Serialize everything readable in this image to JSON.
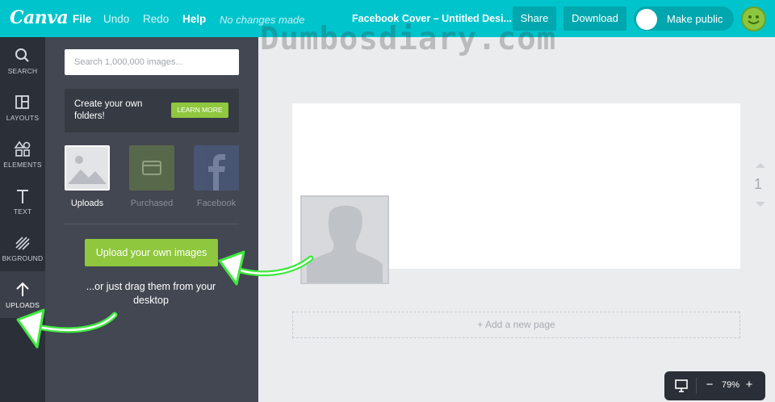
{
  "topbar": {
    "logo": "Canva",
    "menu": [
      "File",
      "Undo",
      "Redo",
      "Help"
    ],
    "status": "No changes made",
    "doc_title": "Facebook Cover – Untitled Desi...",
    "share": "Share",
    "download": "Download",
    "make_public": "Make public"
  },
  "watermark": "Dumbosdiary.com",
  "rail": {
    "items": [
      {
        "label": "SEARCH",
        "icon": "search-icon"
      },
      {
        "label": "LAYOUTS",
        "icon": "layouts-icon"
      },
      {
        "label": "ELEMENTS",
        "icon": "elements-icon"
      },
      {
        "label": "TEXT",
        "icon": "text-icon"
      },
      {
        "label": "BKGROUND",
        "icon": "background-icon"
      },
      {
        "label": "UPLOADS",
        "icon": "upload-icon"
      }
    ],
    "active": "UPLOADS"
  },
  "panel": {
    "search_placeholder": "Search 1,000,000 images...",
    "folder_text": "Create your own folders!",
    "learn_more": "LEARN MORE",
    "tabs": [
      {
        "label": "Uploads",
        "icon": "uploads-image-icon"
      },
      {
        "label": "Purchased",
        "icon": "purchased-card-icon"
      },
      {
        "label": "Facebook",
        "icon": "facebook-icon"
      }
    ],
    "upload_button": "Upload your own images",
    "drag_text": "...or just drag them from your desktop"
  },
  "canvas": {
    "add_page": "+ Add a new page",
    "page_number": "1"
  },
  "zoom": {
    "level": "79%",
    "minus": "−",
    "plus": "+"
  },
  "colors": {
    "brand": "#00c4cc",
    "accent_green": "#8fc73e",
    "rail": "#2a2f38",
    "panel": "#424752"
  }
}
